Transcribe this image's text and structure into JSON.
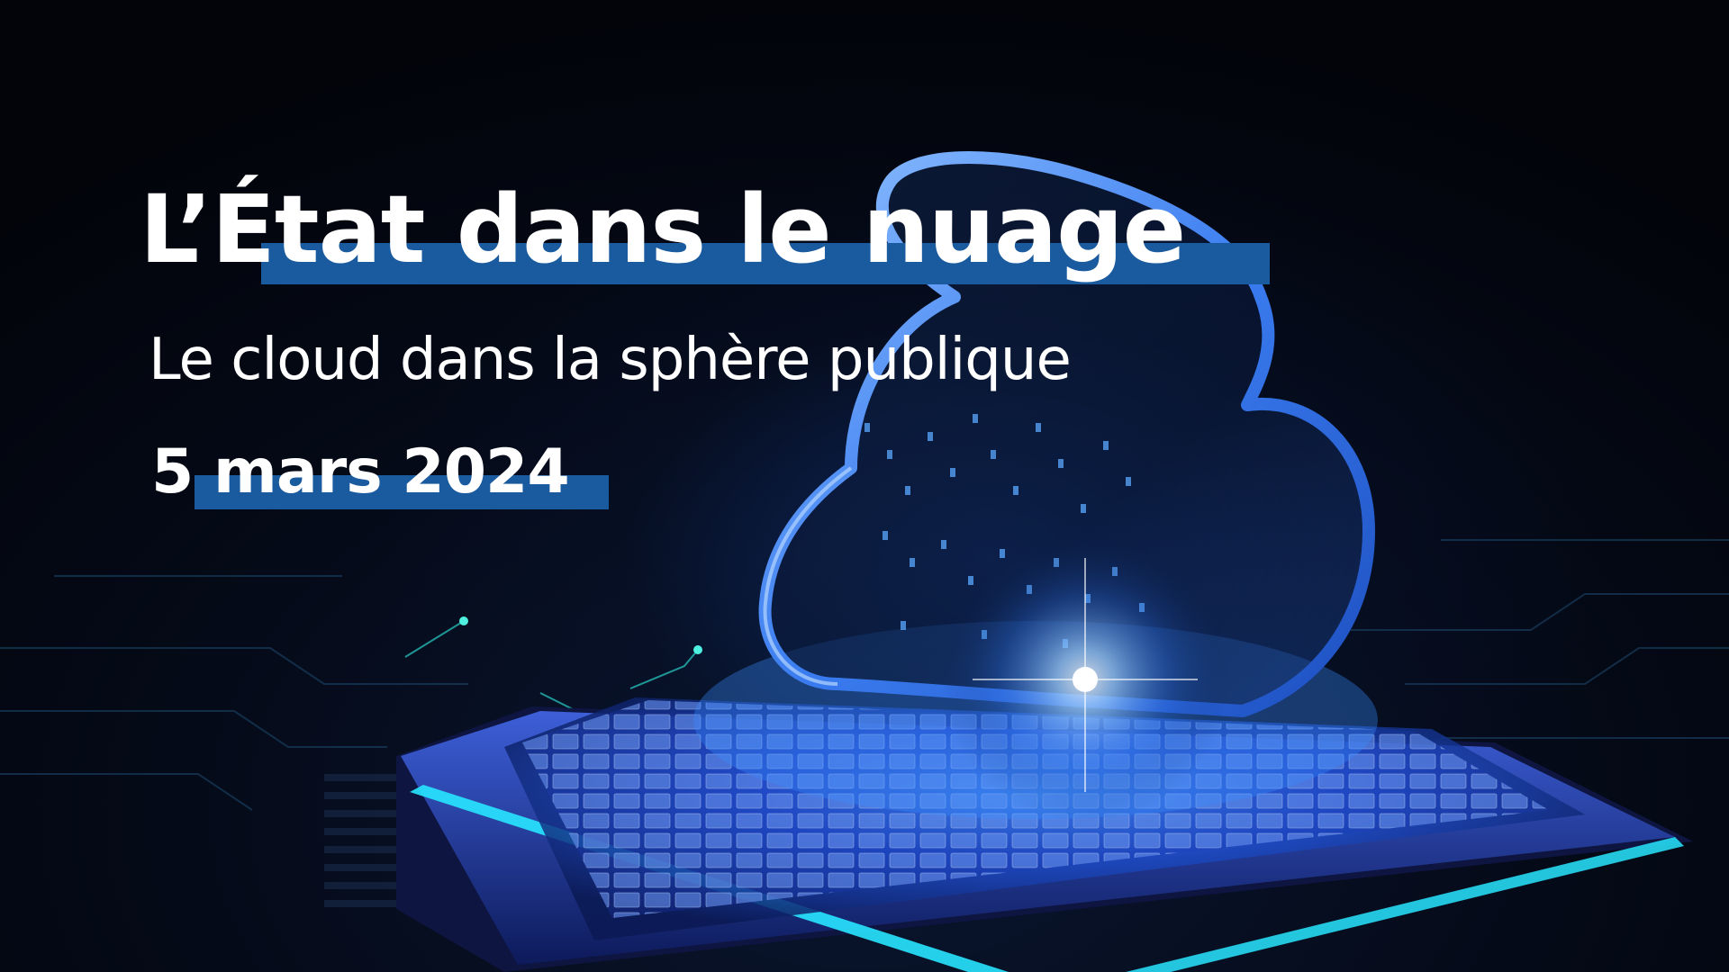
{
  "headline": {
    "title": "L’État dans le nuage",
    "subtitle": "Le cloud dans la sphère publique",
    "date": "5 mars 2024"
  },
  "colors": {
    "background": "#03060d",
    "highlight_bar": "#1a5a9e",
    "text": "#ffffff",
    "glow_blue": "#3d8bff",
    "cyan_strip": "#28e6ff"
  },
  "illustration": {
    "subject": "glowing cloud above computer chip",
    "icon": "cloud-chip-illustration"
  }
}
